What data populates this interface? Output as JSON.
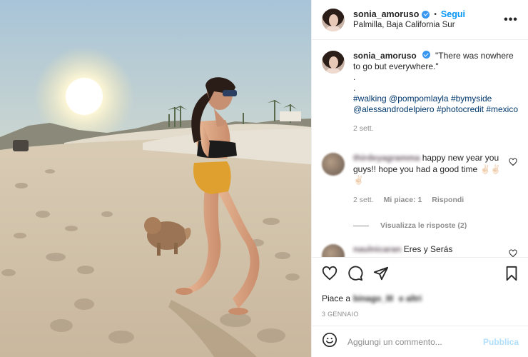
{
  "post": {
    "username": "sonia_amoruso",
    "follow_label": "Segui",
    "separator": "•",
    "location": "Palmilla, Baja California Sur",
    "more_icon": "more-horizontal-icon"
  },
  "caption": {
    "username": "sonia_amoruso",
    "text_line1": "\"There was nowhere to go but everywhere.\"",
    "dot1": ".",
    "dot2": ".",
    "hashtags": [
      {
        "text": "#walking"
      },
      {
        "text": "@pompomlayla"
      },
      {
        "text": "#bymyside"
      },
      {
        "text": "@alessandrodelpiero"
      },
      {
        "text": "#photocredit"
      },
      {
        "text": "#mexico"
      }
    ],
    "time": "2 sett."
  },
  "comments": [
    {
      "username_blurred": "thirdeyagramma",
      "text": "happy new year you guys!! hope you had a good time",
      "emoji": "✌🏻✌🏻✌🏻",
      "time": "2 sett.",
      "likes": "Mi piace: 1",
      "reply": "Rispondi",
      "view_replies": "Visualizza le risposte (2)"
    },
    {
      "username_blurred": "naulnicaran",
      "text": "Eres y Serás"
    }
  ],
  "actions": {
    "like_icon": "heart-icon",
    "comment_icon": "comment-icon",
    "share_icon": "send-icon",
    "save_icon": "bookmark-icon"
  },
  "likes": {
    "prefix": "Piace a",
    "user_blurred": "binago_III",
    "suffix": "e altri"
  },
  "date": "3 GENNAIO",
  "composer": {
    "emoji_icon": "smiley-icon",
    "placeholder": "Aggiungi un commento...",
    "publish_label": "Pubblica"
  },
  "colors": {
    "accent": "#0095f6",
    "link": "#00376b",
    "muted": "#8e8e8e",
    "publish_disabled": "#b2dffc"
  }
}
